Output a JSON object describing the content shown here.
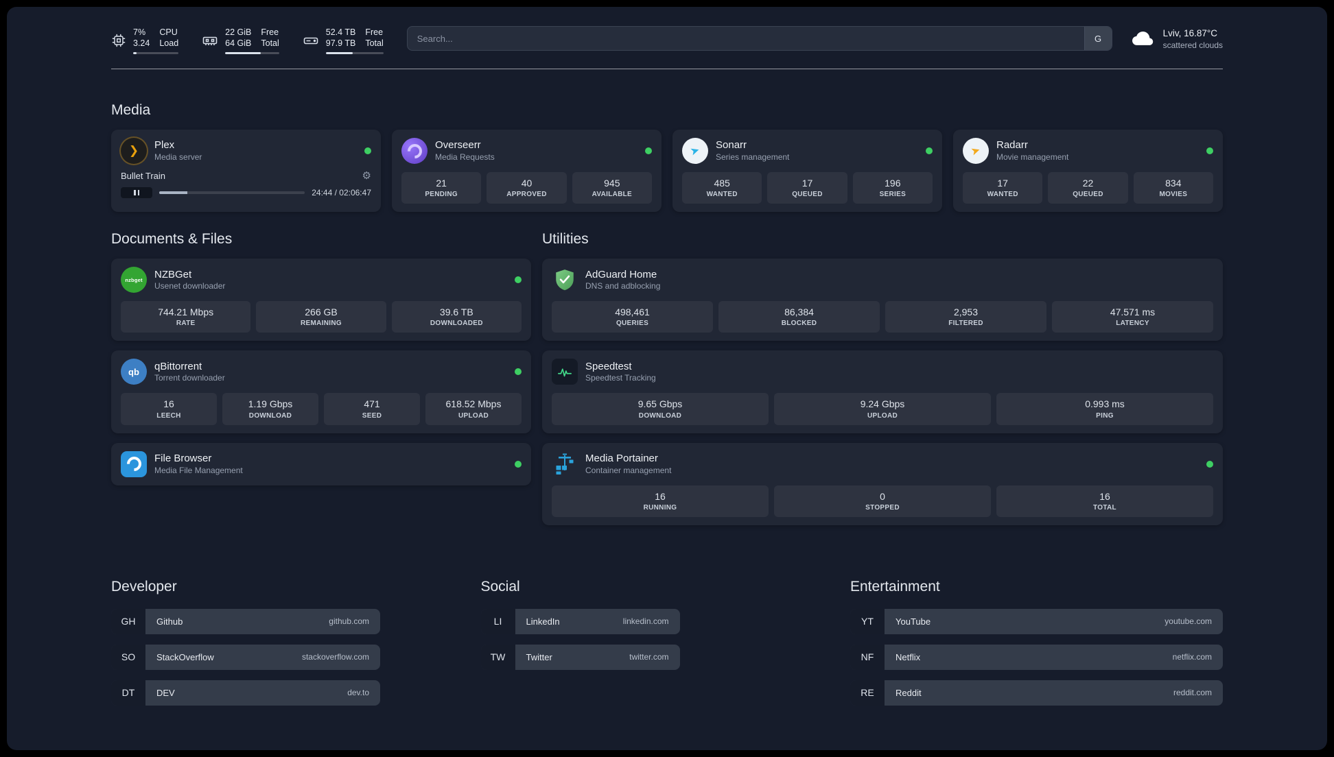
{
  "topbar": {
    "cpu": {
      "value": "7%",
      "sub": "3.24",
      "label_top": "CPU",
      "label_bottom": "Load",
      "percent": 7
    },
    "memory": {
      "value": "22 GiB",
      "sub": "64 GiB",
      "label_top": "Free",
      "label_bottom": "Total",
      "percent": 66
    },
    "disk": {
      "value": "52.4 TB",
      "sub": "97.9 TB",
      "label_top": "Free",
      "label_bottom": "Total",
      "percent": 47
    },
    "search": {
      "placeholder": "Search...",
      "provider_label": "G"
    },
    "weather": {
      "location": "Lviv, 16.87°C",
      "condition": "scattered clouds"
    }
  },
  "media": {
    "header": "Media",
    "plex": {
      "name": "Plex",
      "desc": "Media server",
      "now_playing": "Bullet Train",
      "time": "24:44 / 02:06:47",
      "progress_percent": 19.5
    },
    "overseerr": {
      "name": "Overseerr",
      "desc": "Media Requests",
      "stats": [
        {
          "value": "21",
          "label": "PENDING"
        },
        {
          "value": "40",
          "label": "APPROVED"
        },
        {
          "value": "945",
          "label": "AVAILABLE"
        }
      ]
    },
    "sonarr": {
      "name": "Sonarr",
      "desc": "Series management",
      "stats": [
        {
          "value": "485",
          "label": "WANTED"
        },
        {
          "value": "17",
          "label": "QUEUED"
        },
        {
          "value": "196",
          "label": "SERIES"
        }
      ]
    },
    "radarr": {
      "name": "Radarr",
      "desc": "Movie management",
      "stats": [
        {
          "value": "17",
          "label": "WANTED"
        },
        {
          "value": "22",
          "label": "QUEUED"
        },
        {
          "value": "834",
          "label": "MOVIES"
        }
      ]
    }
  },
  "documents": {
    "header": "Documents & Files",
    "nzbget": {
      "name": "NZBGet",
      "desc": "Usenet downloader",
      "icon_text": "nzbget",
      "stats": [
        {
          "value": "744.21 Mbps",
          "label": "RATE"
        },
        {
          "value": "266 GB",
          "label": "REMAINING"
        },
        {
          "value": "39.6 TB",
          "label": "DOWNLOADED"
        }
      ]
    },
    "qbittorrent": {
      "name": "qBittorrent",
      "desc": "Torrent downloader",
      "icon_text": "qb",
      "stats": [
        {
          "value": "16",
          "label": "LEECH"
        },
        {
          "value": "1.19 Gbps",
          "label": "DOWNLOAD"
        },
        {
          "value": "471",
          "label": "SEED"
        },
        {
          "value": "618.52 Mbps",
          "label": "UPLOAD"
        }
      ]
    },
    "filebrowser": {
      "name": "File Browser",
      "desc": "Media File Management"
    }
  },
  "utilities": {
    "header": "Utilities",
    "adguard": {
      "name": "AdGuard Home",
      "desc": "DNS and adblocking",
      "stats": [
        {
          "value": "498,461",
          "label": "QUERIES"
        },
        {
          "value": "86,384",
          "label": "BLOCKED"
        },
        {
          "value": "2,953",
          "label": "FILTERED"
        },
        {
          "value": "47.571 ms",
          "label": "LATENCY"
        }
      ]
    },
    "speedtest": {
      "name": "Speedtest",
      "desc": "Speedtest Tracking",
      "stats": [
        {
          "value": "9.65 Gbps",
          "label": "DOWNLOAD"
        },
        {
          "value": "9.24 Gbps",
          "label": "UPLOAD"
        },
        {
          "value": "0.993 ms",
          "label": "PING"
        }
      ]
    },
    "portainer": {
      "name": "Media Portainer",
      "desc": "Container management",
      "stats": [
        {
          "value": "16",
          "label": "RUNNING"
        },
        {
          "value": "0",
          "label": "STOPPED"
        },
        {
          "value": "16",
          "label": "TOTAL"
        }
      ]
    }
  },
  "bookmarks": {
    "developer": {
      "header": "Developer",
      "items": [
        {
          "abbr": "GH",
          "name": "Github",
          "domain": "github.com"
        },
        {
          "abbr": "SO",
          "name": "StackOverflow",
          "domain": "stackoverflow.com"
        },
        {
          "abbr": "DT",
          "name": "DEV",
          "domain": "dev.to"
        }
      ]
    },
    "social": {
      "header": "Social",
      "items": [
        {
          "abbr": "LI",
          "name": "LinkedIn",
          "domain": "linkedin.com"
        },
        {
          "abbr": "TW",
          "name": "Twitter",
          "domain": "twitter.com"
        }
      ]
    },
    "entertainment": {
      "header": "Entertainment",
      "items": [
        {
          "abbr": "YT",
          "name": "YouTube",
          "domain": "youtube.com"
        },
        {
          "abbr": "NF",
          "name": "Netflix",
          "domain": "netflix.com"
        },
        {
          "abbr": "RE",
          "name": "Reddit",
          "domain": "reddit.com"
        }
      ]
    }
  },
  "colors": {
    "status_online": "#3ecf63",
    "accent_plex": "#e8a00c",
    "accent_overseerr": "#6f4bd8",
    "accent_sonarr": "#2bb3e6",
    "accent_radarr": "#f2a91e",
    "accent_nzbget": "#33a532",
    "accent_qbittorrent": "#3d7fc4",
    "accent_filebrowser": "#2b95dd",
    "accent_adguard": "#5cab68",
    "accent_speedtest": "#43dd8c",
    "accent_portainer": "#2aa3dc"
  }
}
